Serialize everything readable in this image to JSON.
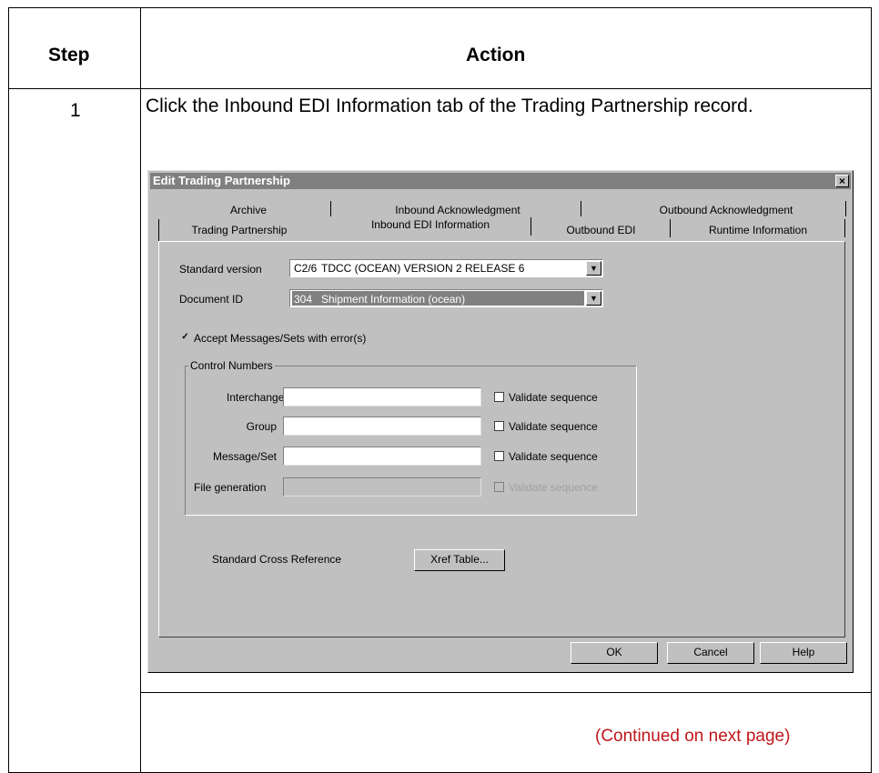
{
  "doc": {
    "header_step": "Step",
    "header_action": "Action",
    "step_number": "1",
    "action_text": "Click the Inbound EDI Information tab of the Trading Partnership record.",
    "continued": "(Continued on next page)"
  },
  "dialog": {
    "title": "Edit Trading Partnership",
    "close": "×",
    "tabs_row1": [
      "Archive",
      "Inbound Acknowledgment",
      "Outbound Acknowledgment"
    ],
    "tabs_row2": [
      "Trading Partnership",
      "Inbound EDI Information",
      "Outbound EDI",
      "Runtime Information"
    ],
    "active_tab": "Inbound EDI Information",
    "standard_version": {
      "label": "Standard version",
      "code": "C2/6",
      "description": "TDCC (OCEAN) VERSION 2 RELEASE 6"
    },
    "document_id": {
      "label": "Document ID",
      "code": "304",
      "description": "Shipment Information (ocean)"
    },
    "accept_messages": {
      "label": "Accept Messages/Sets with error(s)",
      "checked": true
    },
    "control_numbers": {
      "title": "Control Numbers",
      "validate_label": "Validate sequence",
      "rows": [
        {
          "label": "Interchange",
          "value": "",
          "enabled": true
        },
        {
          "label": "Group",
          "value": "",
          "enabled": true
        },
        {
          "label": "Message/Set",
          "value": "",
          "enabled": true
        },
        {
          "label": "File generation",
          "value": "",
          "enabled": false
        }
      ]
    },
    "cross_reference": {
      "label": "Standard Cross Reference",
      "button": "Xref Table..."
    },
    "buttons": {
      "ok": "OK",
      "cancel": "Cancel",
      "help": "Help"
    }
  }
}
